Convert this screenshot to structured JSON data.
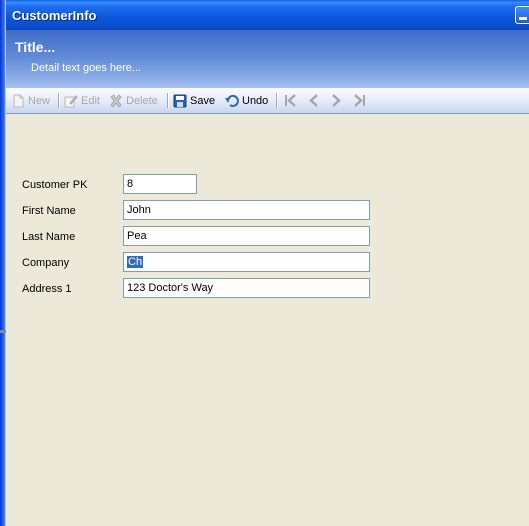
{
  "window": {
    "title": "CustomerInfo"
  },
  "banner": {
    "title": "Title...",
    "detail": "Detail text goes here..."
  },
  "toolbar": {
    "new_label": "New",
    "edit_label": "Edit",
    "delete_label": "Delete",
    "save_label": "Save",
    "undo_label": "Undo"
  },
  "form": {
    "fields": [
      {
        "label": "Customer PK",
        "value": "8"
      },
      {
        "label": "First Name",
        "value": "John"
      },
      {
        "label": "Last Name",
        "value": "Pea"
      },
      {
        "label": "Company",
        "value": "Ch"
      },
      {
        "label": "Address 1",
        "value": "123 Doctor's Way"
      }
    ]
  },
  "colors": {
    "titlebar": "#0a56dc",
    "banner": "#5f8ad8",
    "background": "#ece9d8",
    "selection": "#316ac5",
    "disabled_text": "#a7a6aa"
  },
  "icons": [
    "new-icon",
    "edit-icon",
    "delete-icon",
    "save-icon",
    "undo-icon",
    "first-record-icon",
    "previous-record-icon",
    "next-record-icon",
    "last-record-icon",
    "minimize-icon"
  ]
}
